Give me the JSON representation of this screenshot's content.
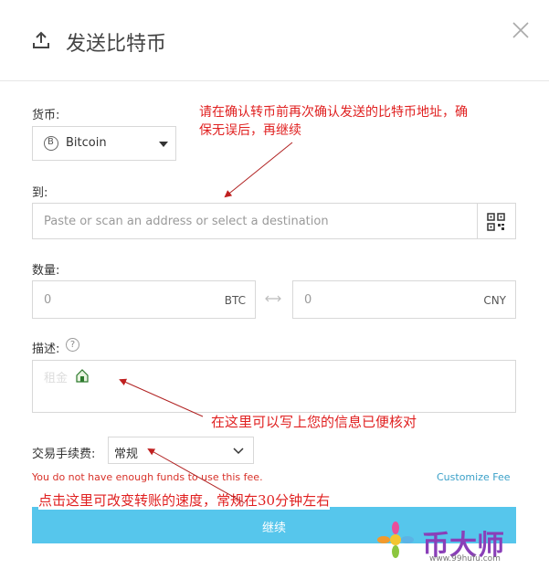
{
  "dialog": {
    "title": "发送比特币"
  },
  "currency": {
    "label": "货币:",
    "selected": "Bitcoin",
    "icon_glyph": "B"
  },
  "to": {
    "label": "到:",
    "placeholder": "Paste or scan an address or select a destination"
  },
  "amount": {
    "label": "数量:",
    "btc_value": "0",
    "btc_unit": "BTC",
    "cny_value": "0",
    "cny_unit": "CNY"
  },
  "description": {
    "label": "描述:",
    "placeholder": "租金"
  },
  "fee": {
    "label": "交易手续费:",
    "selected": "常规",
    "warning": "You do not have enough funds to use this fee.",
    "customize_label": "Customize Fee"
  },
  "continue_button": {
    "label": "继续"
  },
  "annotations": {
    "address_note_line1": "请在确认转币前再次确认发送的比特币地址，确",
    "address_note_line2": "保无误后，再继续",
    "description_note": "在这里可以写上您的信息已便核对",
    "fee_note": "点击这里可改变转账的速度，常规在30分钟左右"
  },
  "watermark": {
    "brand": "币大师",
    "url": "www.99hufu.com"
  }
}
